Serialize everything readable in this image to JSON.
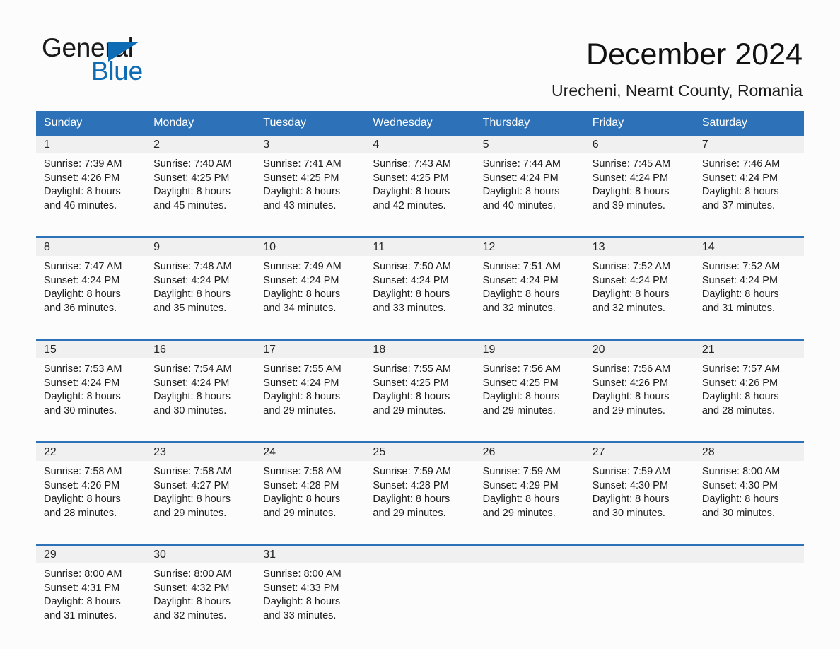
{
  "brand": {
    "line1": "General",
    "line2": "Blue",
    "triangle_color": "#0d6cb4",
    "logo_icon": "general-blue-logo"
  },
  "header": {
    "title": "December 2024",
    "subtitle": "Urecheni, Neamt County, Romania"
  },
  "colors": {
    "header_blue": "#2d72b8",
    "row_separator_blue": "#2d72b8",
    "daynum_band": "#f0f0f0",
    "page_background": "#fcfcfc",
    "text": "#1d1d1d"
  },
  "calendar": {
    "weekday_headers": [
      "Sunday",
      "Monday",
      "Tuesday",
      "Wednesday",
      "Thursday",
      "Friday",
      "Saturday"
    ],
    "weeks": [
      [
        {
          "day": "1",
          "sunrise": "Sunrise: 7:39 AM",
          "sunset": "Sunset: 4:26 PM",
          "daylight_line1": "Daylight: 8 hours",
          "daylight_line2": "and 46 minutes."
        },
        {
          "day": "2",
          "sunrise": "Sunrise: 7:40 AM",
          "sunset": "Sunset: 4:25 PM",
          "daylight_line1": "Daylight: 8 hours",
          "daylight_line2": "and 45 minutes."
        },
        {
          "day": "3",
          "sunrise": "Sunrise: 7:41 AM",
          "sunset": "Sunset: 4:25 PM",
          "daylight_line1": "Daylight: 8 hours",
          "daylight_line2": "and 43 minutes."
        },
        {
          "day": "4",
          "sunrise": "Sunrise: 7:43 AM",
          "sunset": "Sunset: 4:25 PM",
          "daylight_line1": "Daylight: 8 hours",
          "daylight_line2": "and 42 minutes."
        },
        {
          "day": "5",
          "sunrise": "Sunrise: 7:44 AM",
          "sunset": "Sunset: 4:24 PM",
          "daylight_line1": "Daylight: 8 hours",
          "daylight_line2": "and 40 minutes."
        },
        {
          "day": "6",
          "sunrise": "Sunrise: 7:45 AM",
          "sunset": "Sunset: 4:24 PM",
          "daylight_line1": "Daylight: 8 hours",
          "daylight_line2": "and 39 minutes."
        },
        {
          "day": "7",
          "sunrise": "Sunrise: 7:46 AM",
          "sunset": "Sunset: 4:24 PM",
          "daylight_line1": "Daylight: 8 hours",
          "daylight_line2": "and 37 minutes."
        }
      ],
      [
        {
          "day": "8",
          "sunrise": "Sunrise: 7:47 AM",
          "sunset": "Sunset: 4:24 PM",
          "daylight_line1": "Daylight: 8 hours",
          "daylight_line2": "and 36 minutes."
        },
        {
          "day": "9",
          "sunrise": "Sunrise: 7:48 AM",
          "sunset": "Sunset: 4:24 PM",
          "daylight_line1": "Daylight: 8 hours",
          "daylight_line2": "and 35 minutes."
        },
        {
          "day": "10",
          "sunrise": "Sunrise: 7:49 AM",
          "sunset": "Sunset: 4:24 PM",
          "daylight_line1": "Daylight: 8 hours",
          "daylight_line2": "and 34 minutes."
        },
        {
          "day": "11",
          "sunrise": "Sunrise: 7:50 AM",
          "sunset": "Sunset: 4:24 PM",
          "daylight_line1": "Daylight: 8 hours",
          "daylight_line2": "and 33 minutes."
        },
        {
          "day": "12",
          "sunrise": "Sunrise: 7:51 AM",
          "sunset": "Sunset: 4:24 PM",
          "daylight_line1": "Daylight: 8 hours",
          "daylight_line2": "and 32 minutes."
        },
        {
          "day": "13",
          "sunrise": "Sunrise: 7:52 AM",
          "sunset": "Sunset: 4:24 PM",
          "daylight_line1": "Daylight: 8 hours",
          "daylight_line2": "and 32 minutes."
        },
        {
          "day": "14",
          "sunrise": "Sunrise: 7:52 AM",
          "sunset": "Sunset: 4:24 PM",
          "daylight_line1": "Daylight: 8 hours",
          "daylight_line2": "and 31 minutes."
        }
      ],
      [
        {
          "day": "15",
          "sunrise": "Sunrise: 7:53 AM",
          "sunset": "Sunset: 4:24 PM",
          "daylight_line1": "Daylight: 8 hours",
          "daylight_line2": "and 30 minutes."
        },
        {
          "day": "16",
          "sunrise": "Sunrise: 7:54 AM",
          "sunset": "Sunset: 4:24 PM",
          "daylight_line1": "Daylight: 8 hours",
          "daylight_line2": "and 30 minutes."
        },
        {
          "day": "17",
          "sunrise": "Sunrise: 7:55 AM",
          "sunset": "Sunset: 4:24 PM",
          "daylight_line1": "Daylight: 8 hours",
          "daylight_line2": "and 29 minutes."
        },
        {
          "day": "18",
          "sunrise": "Sunrise: 7:55 AM",
          "sunset": "Sunset: 4:25 PM",
          "daylight_line1": "Daylight: 8 hours",
          "daylight_line2": "and 29 minutes."
        },
        {
          "day": "19",
          "sunrise": "Sunrise: 7:56 AM",
          "sunset": "Sunset: 4:25 PM",
          "daylight_line1": "Daylight: 8 hours",
          "daylight_line2": "and 29 minutes."
        },
        {
          "day": "20",
          "sunrise": "Sunrise: 7:56 AM",
          "sunset": "Sunset: 4:26 PM",
          "daylight_line1": "Daylight: 8 hours",
          "daylight_line2": "and 29 minutes."
        },
        {
          "day": "21",
          "sunrise": "Sunrise: 7:57 AM",
          "sunset": "Sunset: 4:26 PM",
          "daylight_line1": "Daylight: 8 hours",
          "daylight_line2": "and 28 minutes."
        }
      ],
      [
        {
          "day": "22",
          "sunrise": "Sunrise: 7:58 AM",
          "sunset": "Sunset: 4:26 PM",
          "daylight_line1": "Daylight: 8 hours",
          "daylight_line2": "and 28 minutes."
        },
        {
          "day": "23",
          "sunrise": "Sunrise: 7:58 AM",
          "sunset": "Sunset: 4:27 PM",
          "daylight_line1": "Daylight: 8 hours",
          "daylight_line2": "and 29 minutes."
        },
        {
          "day": "24",
          "sunrise": "Sunrise: 7:58 AM",
          "sunset": "Sunset: 4:28 PM",
          "daylight_line1": "Daylight: 8 hours",
          "daylight_line2": "and 29 minutes."
        },
        {
          "day": "25",
          "sunrise": "Sunrise: 7:59 AM",
          "sunset": "Sunset: 4:28 PM",
          "daylight_line1": "Daylight: 8 hours",
          "daylight_line2": "and 29 minutes."
        },
        {
          "day": "26",
          "sunrise": "Sunrise: 7:59 AM",
          "sunset": "Sunset: 4:29 PM",
          "daylight_line1": "Daylight: 8 hours",
          "daylight_line2": "and 29 minutes."
        },
        {
          "day": "27",
          "sunrise": "Sunrise: 7:59 AM",
          "sunset": "Sunset: 4:30 PM",
          "daylight_line1": "Daylight: 8 hours",
          "daylight_line2": "and 30 minutes."
        },
        {
          "day": "28",
          "sunrise": "Sunrise: 8:00 AM",
          "sunset": "Sunset: 4:30 PM",
          "daylight_line1": "Daylight: 8 hours",
          "daylight_line2": "and 30 minutes."
        }
      ],
      [
        {
          "day": "29",
          "sunrise": "Sunrise: 8:00 AM",
          "sunset": "Sunset: 4:31 PM",
          "daylight_line1": "Daylight: 8 hours",
          "daylight_line2": "and 31 minutes."
        },
        {
          "day": "30",
          "sunrise": "Sunrise: 8:00 AM",
          "sunset": "Sunset: 4:32 PM",
          "daylight_line1": "Daylight: 8 hours",
          "daylight_line2": "and 32 minutes."
        },
        {
          "day": "31",
          "sunrise": "Sunrise: 8:00 AM",
          "sunset": "Sunset: 4:33 PM",
          "daylight_line1": "Daylight: 8 hours",
          "daylight_line2": "and 33 minutes."
        },
        {
          "day": "",
          "sunrise": "",
          "sunset": "",
          "daylight_line1": "",
          "daylight_line2": ""
        },
        {
          "day": "",
          "sunrise": "",
          "sunset": "",
          "daylight_line1": "",
          "daylight_line2": ""
        },
        {
          "day": "",
          "sunrise": "",
          "sunset": "",
          "daylight_line1": "",
          "daylight_line2": ""
        },
        {
          "day": "",
          "sunrise": "",
          "sunset": "",
          "daylight_line1": "",
          "daylight_line2": ""
        }
      ]
    ]
  }
}
